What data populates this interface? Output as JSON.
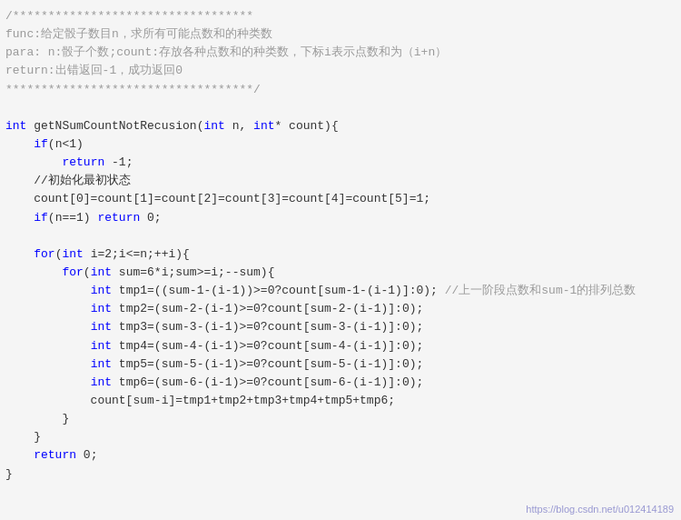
{
  "code": {
    "lines": [
      {
        "type": "comment",
        "text": "/**********************************"
      },
      {
        "type": "comment",
        "text": "func:给定骰子数目n，求所有可能点数和的种类数"
      },
      {
        "type": "comment",
        "text": "para: n:骰子个数;count:存放各种点数和的种类数，下标i表示点数和为（i+n）"
      },
      {
        "type": "comment",
        "text": "return:出错返回-1，成功返回0"
      },
      {
        "type": "comment",
        "text": "***********************************/"
      },
      {
        "type": "blank"
      },
      {
        "type": "code",
        "text": "int getNSumCountNotRecusion(int n, int* count){"
      },
      {
        "type": "code",
        "text": "    if(n<1)"
      },
      {
        "type": "code",
        "text": "        return -1;"
      },
      {
        "type": "code",
        "text": "    //初始化最初状态"
      },
      {
        "type": "code",
        "text": "    count[0]=count[1]=count[2]=count[3]=count[4]=count[5]=1;"
      },
      {
        "type": "code",
        "text": "    if(n==1) return 0;"
      },
      {
        "type": "blank"
      },
      {
        "type": "code",
        "text": "    for(int i=2;i<=n;++i){"
      },
      {
        "type": "code",
        "text": "        for(int sum=6*i;sum>=i;--sum){"
      },
      {
        "type": "code_comment",
        "code": "            int tmp1=((sum-1-(i-1))>=0?count[sum-1-(i-1)]:0); ",
        "comment": "//上一阶段点数和sum-1的排列总数"
      },
      {
        "type": "code",
        "text": "            int tmp2=(sum-2-(i-1)>=0?count[sum-2-(i-1)]:0);"
      },
      {
        "type": "code",
        "text": "            int tmp3=(sum-3-(i-1)>=0?count[sum-3-(i-1)]:0);"
      },
      {
        "type": "code",
        "text": "            int tmp4=(sum-4-(i-1)>=0?count[sum-4-(i-1)]:0);"
      },
      {
        "type": "code",
        "text": "            int tmp5=(sum-5-(i-1)>=0?count[sum-5-(i-1)]:0);"
      },
      {
        "type": "code",
        "text": "            int tmp6=(sum-6-(i-1)>=0?count[sum-6-(i-1)]:0);"
      },
      {
        "type": "code",
        "text": "            count[sum-i]=tmp1+tmp2+tmp3+tmp4+tmp5+tmp6;"
      },
      {
        "type": "code",
        "text": "        }"
      },
      {
        "type": "code",
        "text": "    }"
      },
      {
        "type": "code",
        "text": "    return 0;"
      },
      {
        "type": "code",
        "text": "}"
      }
    ]
  },
  "watermark": "https://blog.csdn.net/u012414189"
}
